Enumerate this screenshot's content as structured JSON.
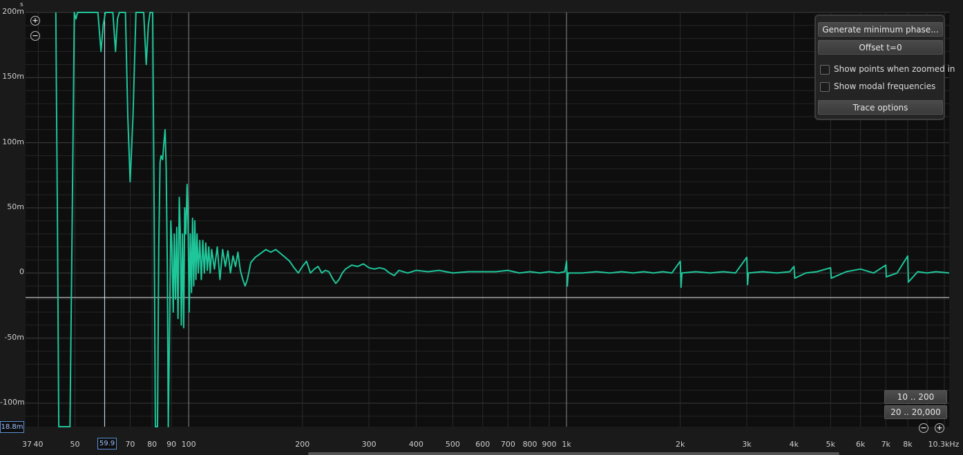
{
  "chart_data": {
    "type": "line",
    "y_unit": "s",
    "yticks": [
      {
        "value": 0.2,
        "label": "200m"
      },
      {
        "value": 0.15,
        "label": "150m"
      },
      {
        "value": 0.1,
        "label": "100m"
      },
      {
        "value": 0.05,
        "label": "50m"
      },
      {
        "value": 0,
        "label": "0"
      },
      {
        "value": -0.05,
        "label": "-50m"
      },
      {
        "value": -0.1,
        "label": "-100m"
      }
    ],
    "ylim": [
      -0.118,
      0.2
    ],
    "xlim": [
      37,
      10300
    ],
    "xscale": "log",
    "xticks": [
      {
        "value": 37,
        "label": "37"
      },
      {
        "value": 40,
        "label": "40"
      },
      {
        "value": 50,
        "label": "50"
      },
      {
        "value": 70,
        "label": "70"
      },
      {
        "value": 80,
        "label": "80"
      },
      {
        "value": 90,
        "label": "90"
      },
      {
        "value": 100,
        "label": "100"
      },
      {
        "value": 200,
        "label": "200"
      },
      {
        "value": 300,
        "label": "300"
      },
      {
        "value": 400,
        "label": "400"
      },
      {
        "value": 500,
        "label": "500"
      },
      {
        "value": 600,
        "label": "600"
      },
      {
        "value": 700,
        "label": "700"
      },
      {
        "value": 800,
        "label": "800"
      },
      {
        "value": 900,
        "label": "900"
      },
      {
        "value": 1000,
        "label": "1k"
      },
      {
        "value": 2000,
        "label": "2k"
      },
      {
        "value": 3000,
        "label": "3k"
      },
      {
        "value": 4000,
        "label": "4k"
      },
      {
        "value": 5000,
        "label": "5k"
      },
      {
        "value": 6000,
        "label": "6k"
      },
      {
        "value": 7000,
        "label": "7k"
      },
      {
        "value": 8000,
        "label": "8k"
      },
      {
        "value": 10300,
        "label": "10.3kHz"
      }
    ],
    "major_grid_x": [
      100,
      1000
    ],
    "grid": true,
    "cursor": {
      "x": 59.9,
      "x_label": "59.9",
      "y": -0.0188,
      "y_label": "18.8m"
    },
    "series": [
      {
        "color": "#1ec79a",
        "points": [
          [
            44.5,
            0.2
          ],
          [
            44.9,
            0.05
          ],
          [
            45.3,
            -0.118
          ],
          [
            48.5,
            -0.118
          ],
          [
            49.2,
            0.05
          ],
          [
            49.8,
            0.2
          ],
          [
            50.3,
            0.195
          ],
          [
            50.8,
            0.2
          ],
          [
            57.5,
            0.2
          ],
          [
            58.6,
            0.17
          ],
          [
            59.4,
            0.19
          ],
          [
            60.2,
            0.2
          ],
          [
            63,
            0.2
          ],
          [
            64,
            0.17
          ],
          [
            64.8,
            0.195
          ],
          [
            65.5,
            0.2
          ],
          [
            68,
            0.2
          ],
          [
            69,
            0.12
          ],
          [
            70,
            0.07
          ],
          [
            71.2,
            0.12
          ],
          [
            72.5,
            0.2
          ],
          [
            76,
            0.2
          ],
          [
            77.2,
            0.16
          ],
          [
            78.2,
            0.19
          ],
          [
            79,
            0.2
          ],
          [
            80.3,
            0.2
          ],
          [
            81,
            0.05
          ],
          [
            81.6,
            -0.118
          ],
          [
            82.7,
            -0.118
          ],
          [
            83.3,
            0.02
          ],
          [
            84,
            0.085
          ],
          [
            84.5,
            0.09
          ],
          [
            85.3,
            0.087
          ],
          [
            86,
            0.1
          ],
          [
            86.6,
            0.11
          ],
          [
            87.2,
            0.08
          ],
          [
            87.8,
            0.0
          ],
          [
            88.3,
            -0.118
          ],
          [
            89,
            -0.04
          ],
          [
            89.7,
            0.04
          ],
          [
            90.3,
            0.02
          ],
          [
            91,
            -0.03
          ],
          [
            91.6,
            0.03
          ],
          [
            92.3,
            -0.02
          ],
          [
            93,
            0.035
          ],
          [
            93.7,
            -0.035
          ],
          [
            94.4,
            0.058
          ],
          [
            95,
            0.03
          ],
          [
            95.6,
            -0.04
          ],
          [
            96.3,
            0.03
          ],
          [
            97,
            -0.042
          ],
          [
            97.6,
            0.05
          ],
          [
            98.3,
            0.03
          ],
          [
            99,
            0.068
          ],
          [
            99.6,
            0.04
          ],
          [
            100.3,
            -0.03
          ],
          [
            101,
            0.03
          ],
          [
            101.7,
            -0.015
          ],
          [
            102.4,
            0.042
          ],
          [
            103.1,
            -0.01
          ],
          [
            103.8,
            0.04
          ],
          [
            104.5,
            -0.005
          ],
          [
            105.2,
            0.03
          ],
          [
            106,
            0.0
          ],
          [
            107,
            0.025
          ],
          [
            108,
            -0.005
          ],
          [
            109,
            0.025
          ],
          [
            110,
            0.0
          ],
          [
            111,
            0.023
          ],
          [
            112,
            0.002
          ],
          [
            113,
            0.02
          ],
          [
            114,
            0.0
          ],
          [
            115,
            0.018
          ],
          [
            117,
            0.003
          ],
          [
            119,
            0.02
          ],
          [
            121,
            -0.005
          ],
          [
            123,
            0.018
          ],
          [
            125,
            0.005
          ],
          [
            127,
            0.017
          ],
          [
            129,
            0.0
          ],
          [
            131,
            0.013
          ],
          [
            133,
            0.005
          ],
          [
            135,
            0.016
          ],
          [
            137,
            0.002
          ],
          [
            139,
            -0.005
          ],
          [
            141,
            -0.01
          ],
          [
            143,
            -0.005
          ],
          [
            146,
            0.008
          ],
          [
            150,
            0.012
          ],
          [
            155,
            0.015
          ],
          [
            160,
            0.018
          ],
          [
            165,
            0.016
          ],
          [
            170,
            0.018
          ],
          [
            175,
            0.015
          ],
          [
            180,
            0.012
          ],
          [
            185,
            0.009
          ],
          [
            190,
            0.004
          ],
          [
            195,
            0.0
          ],
          [
            200,
            0.005
          ],
          [
            205,
            0.009
          ],
          [
            210,
            0.0
          ],
          [
            215,
            0.003
          ],
          [
            220,
            0.005
          ],
          [
            225,
            0.0
          ],
          [
            230,
            0.002
          ],
          [
            235,
            0.001
          ],
          [
            240,
            -0.004
          ],
          [
            245,
            -0.008
          ],
          [
            250,
            -0.005
          ],
          [
            255,
            0.0
          ],
          [
            260,
            0.003
          ],
          [
            270,
            0.006
          ],
          [
            280,
            0.005
          ],
          [
            290,
            0.007
          ],
          [
            300,
            0.004
          ],
          [
            310,
            0.003
          ],
          [
            320,
            0.004
          ],
          [
            330,
            0.003
          ],
          [
            340,
            0.0
          ],
          [
            350,
            -0.002
          ],
          [
            360,
            0.002
          ],
          [
            380,
            0.0
          ],
          [
            400,
            0.002
          ],
          [
            430,
            0.001
          ],
          [
            460,
            0.002
          ],
          [
            500,
            0.0
          ],
          [
            550,
            0.001
          ],
          [
            600,
            0.001
          ],
          [
            650,
            0.001
          ],
          [
            700,
            0.002
          ],
          [
            750,
            0.0
          ],
          [
            800,
            0.001
          ],
          [
            850,
            0.0
          ],
          [
            900,
            0.001
          ],
          [
            950,
            0.0
          ],
          [
            990,
            0.001
          ],
          [
            1000,
            0.009
          ],
          [
            1005,
            -0.01
          ],
          [
            1010,
            0.0
          ],
          [
            1100,
            0.0
          ],
          [
            1200,
            0.001
          ],
          [
            1300,
            0.0
          ],
          [
            1400,
            0.001
          ],
          [
            1500,
            0.0
          ],
          [
            1600,
            0.001
          ],
          [
            1700,
            0.0
          ],
          [
            1800,
            0.001
          ],
          [
            1900,
            0.0
          ],
          [
            2000,
            0.009
          ],
          [
            2010,
            -0.011
          ],
          [
            2020,
            0.0
          ],
          [
            2200,
            0.001
          ],
          [
            2400,
            0.0
          ],
          [
            2600,
            0.001
          ],
          [
            2800,
            0.0
          ],
          [
            3000,
            0.012
          ],
          [
            3015,
            -0.009
          ],
          [
            3030,
            0.0
          ],
          [
            3300,
            0.001
          ],
          [
            3600,
            0.0
          ],
          [
            3900,
            0.001
          ],
          [
            4000,
            0.005
          ],
          [
            4020,
            -0.004
          ],
          [
            4300,
            0.0
          ],
          [
            4600,
            0.001
          ],
          [
            5000,
            0.004
          ],
          [
            5020,
            -0.004
          ],
          [
            5500,
            0.001
          ],
          [
            6000,
            0.003
          ],
          [
            6500,
            0.0
          ],
          [
            7000,
            0.006
          ],
          [
            7020,
            -0.003
          ],
          [
            7500,
            0.0
          ],
          [
            8000,
            0.013
          ],
          [
            8030,
            -0.007
          ],
          [
            8500,
            0.001
          ],
          [
            9000,
            0.0
          ],
          [
            9500,
            0.001
          ],
          [
            10300,
            0.0
          ]
        ]
      }
    ]
  },
  "panel": {
    "generate_min_phase_label": "Generate minimum phase...",
    "offset_label": "Offset t=0",
    "show_points_label": "Show points when zoomed in",
    "show_modal_label": "Show modal frequencies",
    "trace_options_label": "Trace options"
  },
  "range_buttons": {
    "low_label": "10 .. 200",
    "full_label": "20 .. 20,000"
  }
}
